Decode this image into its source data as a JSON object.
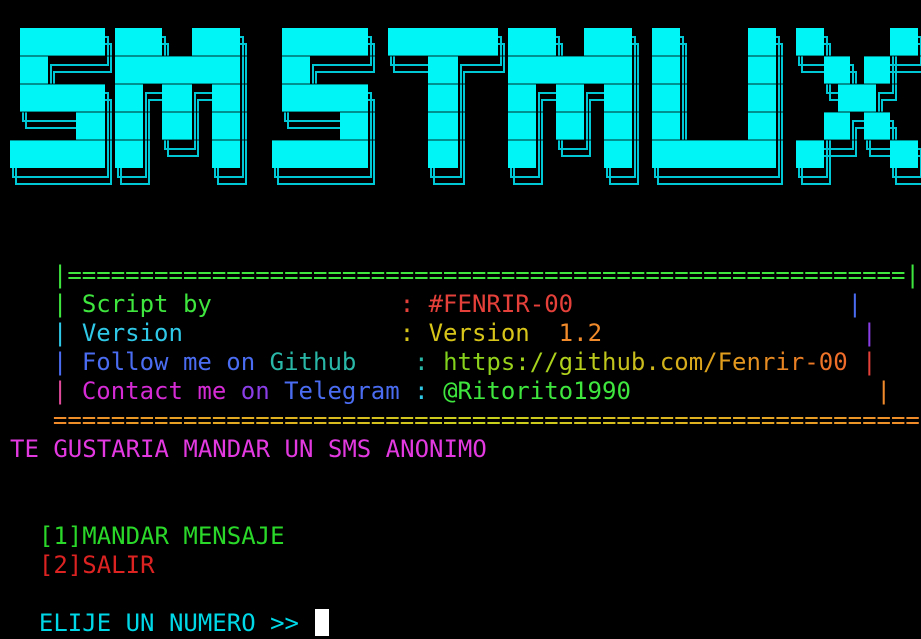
{
  "banner": {
    "text": "SMSTMUX",
    "fill_color": "#00f6f6",
    "outline_color": "#00c8d4"
  },
  "info_box": {
    "border_top": "|==========================================================|",
    "border_bottom": "============================================================",
    "pipe": "|",
    "colon": ":",
    "rows": [
      {
        "label": "Script by            ",
        "value": "#FENRIR-00"
      },
      {
        "label": "Version              ",
        "value_parts": [
          "Version",
          "  ",
          "1.2"
        ]
      },
      {
        "label_parts": [
          "Follow me",
          " on ",
          "Github   "
        ],
        "value": "https://github.com/Fenrir-00"
      },
      {
        "label_parts": [
          "Contact me",
          " on ",
          "Telegram"
        ],
        "value": "@Ritorito1990"
      }
    ]
  },
  "question": "TE GUSTARIA MANDAR UN SMS ANONIMO",
  "menu": [
    {
      "key": "[1]",
      "label": "MANDAR MENSAJE"
    },
    {
      "key": "[2]",
      "label": "SALIR"
    }
  ],
  "prompt": "ELIJE UN NUMERO >> "
}
